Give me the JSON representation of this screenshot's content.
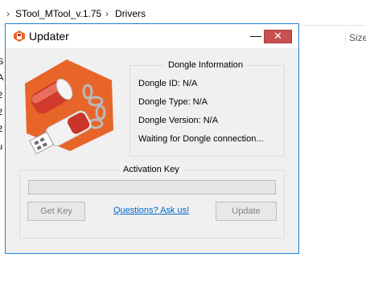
{
  "explorer": {
    "breadcrumb": [
      "STool_MTool_v.1.75",
      "Drivers"
    ],
    "chevron": "›",
    "left_fragments": [
      "S",
      "A",
      "2",
      "2",
      "2",
      "u"
    ],
    "column_size": "Size"
  },
  "dialog": {
    "title": "Updater",
    "minimize_glyph": "—",
    "close_glyph": "✕",
    "dongle": {
      "legend": "Dongle Information",
      "id": "Dongle ID: N/A",
      "type": "Dongle Type: N/A",
      "version": "Dongle Version: N/A",
      "status": "Waiting for Dongle connection..."
    },
    "activation": {
      "legend": "Activation Key",
      "key_value": "",
      "get_key_label": "Get Key",
      "link_label": "Questions? Ask us!",
      "update_label": "Update"
    }
  },
  "colors": {
    "window_border": "#1f7fd3",
    "close_button": "#c75050",
    "logo_orange": "#e8652a",
    "link": "#0066cc"
  },
  "icons": [
    "app-icon",
    "chevron-icon",
    "minimize-icon",
    "close-icon",
    "usb-key-logo"
  ]
}
